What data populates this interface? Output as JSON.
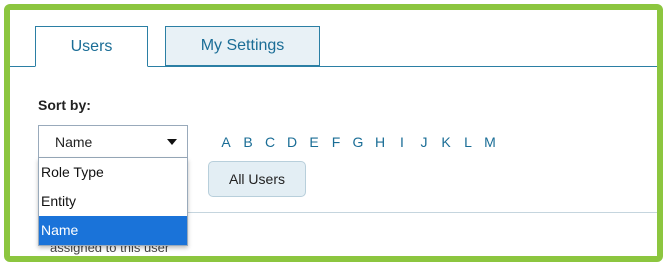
{
  "tabs": [
    {
      "label": "Users",
      "active": true
    },
    {
      "label": "My Settings",
      "active": false
    }
  ],
  "sort": {
    "label": "Sort by:",
    "selected": "Name",
    "options": [
      "Role Type",
      "Entity",
      "Name"
    ]
  },
  "letters": [
    "A",
    "B",
    "C",
    "D",
    "E",
    "F",
    "G",
    "H",
    "I",
    "J",
    "K",
    "L",
    "M"
  ],
  "all_users_label": "All Users",
  "partial_text": "assigned to this user",
  "colors": {
    "frame": "#8cc63f",
    "accent": "#1a6d96",
    "selected_option": "#1a73d9"
  }
}
